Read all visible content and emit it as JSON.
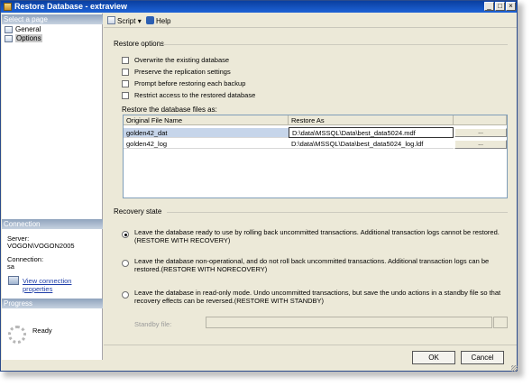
{
  "window": {
    "title": "Restore Database - extraview",
    "min_glyph": "_",
    "max_glyph": "□",
    "close_glyph": "×"
  },
  "left": {
    "select_page_header": "Select a page",
    "pages": [
      {
        "label": "General",
        "icon": "page-icon"
      },
      {
        "label": "Options",
        "icon": "page-icon",
        "selected": true
      }
    ],
    "connection_header": "Connection",
    "server_label": "Server:",
    "server_value": "VOGON\\VOGON2005",
    "connection_label": "Connection:",
    "connection_value": "sa",
    "view_props_link": "View connection properties",
    "progress_header": "Progress",
    "progress_status": "Ready"
  },
  "toolbar": {
    "script_label": "Script",
    "script_dropdown_glyph": "▾",
    "help_label": "Help"
  },
  "restore_options": {
    "title": "Restore options",
    "checkboxes": [
      {
        "label": "Overwrite the existing database",
        "checked": false
      },
      {
        "label": "Preserve the replication settings",
        "checked": false
      },
      {
        "label": "Prompt before restoring each backup",
        "checked": false
      },
      {
        "label": "Restrict access to the restored database",
        "checked": false
      }
    ],
    "files_label": "Restore the database files as:",
    "columns": [
      "Original File Name",
      "Restore As"
    ],
    "rows": [
      {
        "original": "golden42_dat",
        "restore_as": "D:\\data\\MSSQL\\Data\\best_data5024.mdf",
        "browse": "..."
      },
      {
        "original": "golden42_log",
        "restore_as": "D:\\data\\MSSQL\\Data\\best_data5024_log.ldf",
        "browse": "..."
      }
    ]
  },
  "recovery_state": {
    "title": "Recovery state",
    "options": [
      {
        "text": "Leave the database ready to use by rolling back uncommitted transactions. Additional transaction logs cannot be restored.(RESTORE WITH RECOVERY)",
        "selected": true
      },
      {
        "text": "Leave the database non-operational, and do not roll back uncommitted transactions. Additional transaction logs can be restored.(RESTORE WITH NORECOVERY)",
        "selected": false
      },
      {
        "text": "Leave the database in read-only mode. Undo uncommitted transactions, but save the undo actions in a standby file so that recovery effects can be reversed.(RESTORE WITH STANDBY)",
        "selected": false
      }
    ],
    "standby_label": "Standby file:",
    "standby_value": "",
    "standby_browse": ""
  },
  "footer": {
    "ok_label": "OK",
    "cancel_label": "Cancel"
  }
}
